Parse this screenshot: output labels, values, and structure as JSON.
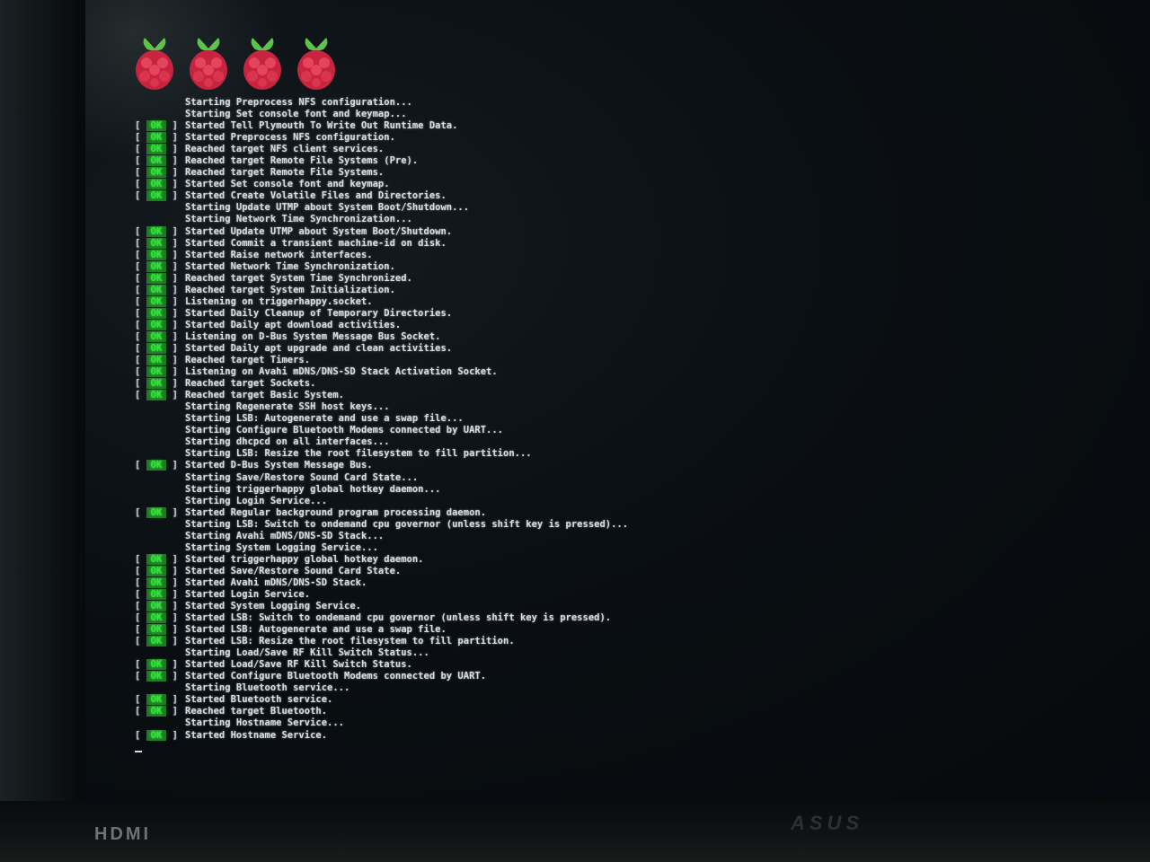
{
  "monitor": {
    "hdmi_label": "HDMI",
    "brand_label": "ASUS"
  },
  "boot": {
    "ok_label": "OK",
    "lines": [
      {
        "status": "",
        "text": "Starting Preprocess NFS configuration..."
      },
      {
        "status": "",
        "text": "Starting Set console font and keymap..."
      },
      {
        "status": "OK",
        "text": "Started Tell Plymouth To Write Out Runtime Data."
      },
      {
        "status": "OK",
        "text": "Started Preprocess NFS configuration."
      },
      {
        "status": "OK",
        "text": "Reached target NFS client services."
      },
      {
        "status": "OK",
        "text": "Reached target Remote File Systems (Pre)."
      },
      {
        "status": "OK",
        "text": "Reached target Remote File Systems."
      },
      {
        "status": "OK",
        "text": "Started Set console font and keymap."
      },
      {
        "status": "OK",
        "text": "Started Create Volatile Files and Directories."
      },
      {
        "status": "",
        "text": "Starting Update UTMP about System Boot/Shutdown..."
      },
      {
        "status": "",
        "text": "Starting Network Time Synchronization..."
      },
      {
        "status": "OK",
        "text": "Started Update UTMP about System Boot/Shutdown."
      },
      {
        "status": "OK",
        "text": "Started Commit a transient machine-id on disk."
      },
      {
        "status": "OK",
        "text": "Started Raise network interfaces."
      },
      {
        "status": "OK",
        "text": "Started Network Time Synchronization."
      },
      {
        "status": "OK",
        "text": "Reached target System Time Synchronized."
      },
      {
        "status": "OK",
        "text": "Reached target System Initialization."
      },
      {
        "status": "OK",
        "text": "Listening on triggerhappy.socket."
      },
      {
        "status": "OK",
        "text": "Started Daily Cleanup of Temporary Directories."
      },
      {
        "status": "OK",
        "text": "Started Daily apt download activities."
      },
      {
        "status": "OK",
        "text": "Listening on D-Bus System Message Bus Socket."
      },
      {
        "status": "OK",
        "text": "Started Daily apt upgrade and clean activities."
      },
      {
        "status": "OK",
        "text": "Reached target Timers."
      },
      {
        "status": "OK",
        "text": "Listening on Avahi mDNS/DNS-SD Stack Activation Socket."
      },
      {
        "status": "OK",
        "text": "Reached target Sockets."
      },
      {
        "status": "OK",
        "text": "Reached target Basic System."
      },
      {
        "status": "",
        "text": "Starting Regenerate SSH host keys..."
      },
      {
        "status": "",
        "text": "Starting LSB: Autogenerate and use a swap file..."
      },
      {
        "status": "",
        "text": "Starting Configure Bluetooth Modems connected by UART..."
      },
      {
        "status": "",
        "text": "Starting dhcpcd on all interfaces..."
      },
      {
        "status": "",
        "text": "Starting LSB: Resize the root filesystem to fill partition..."
      },
      {
        "status": "OK",
        "text": "Started D-Bus System Message Bus."
      },
      {
        "status": "",
        "text": "Starting Save/Restore Sound Card State..."
      },
      {
        "status": "",
        "text": "Starting triggerhappy global hotkey daemon..."
      },
      {
        "status": "",
        "text": "Starting Login Service..."
      },
      {
        "status": "OK",
        "text": "Started Regular background program processing daemon."
      },
      {
        "status": "",
        "text": "Starting LSB: Switch to ondemand cpu governor (unless shift key is pressed)..."
      },
      {
        "status": "",
        "text": "Starting Avahi mDNS/DNS-SD Stack..."
      },
      {
        "status": "",
        "text": "Starting System Logging Service..."
      },
      {
        "status": "OK",
        "text": "Started triggerhappy global hotkey daemon."
      },
      {
        "status": "OK",
        "text": "Started Save/Restore Sound Card State."
      },
      {
        "status": "OK",
        "text": "Started Avahi mDNS/DNS-SD Stack."
      },
      {
        "status": "OK",
        "text": "Started Login Service."
      },
      {
        "status": "OK",
        "text": "Started System Logging Service."
      },
      {
        "status": "OK",
        "text": "Started LSB: Switch to ondemand cpu governor (unless shift key is pressed)."
      },
      {
        "status": "OK",
        "text": "Started LSB: Autogenerate and use a swap file."
      },
      {
        "status": "OK",
        "text": "Started LSB: Resize the root filesystem to fill partition."
      },
      {
        "status": "",
        "text": "Starting Load/Save RF Kill Switch Status..."
      },
      {
        "status": "OK",
        "text": "Started Load/Save RF Kill Switch Status."
      },
      {
        "status": "OK",
        "text": "Started Configure Bluetooth Modems connected by UART."
      },
      {
        "status": "",
        "text": "Starting Bluetooth service..."
      },
      {
        "status": "OK",
        "text": "Started Bluetooth service."
      },
      {
        "status": "OK",
        "text": "Reached target Bluetooth."
      },
      {
        "status": "",
        "text": "Starting Hostname Service..."
      },
      {
        "status": "OK",
        "text": "Started Hostname Service."
      }
    ]
  }
}
